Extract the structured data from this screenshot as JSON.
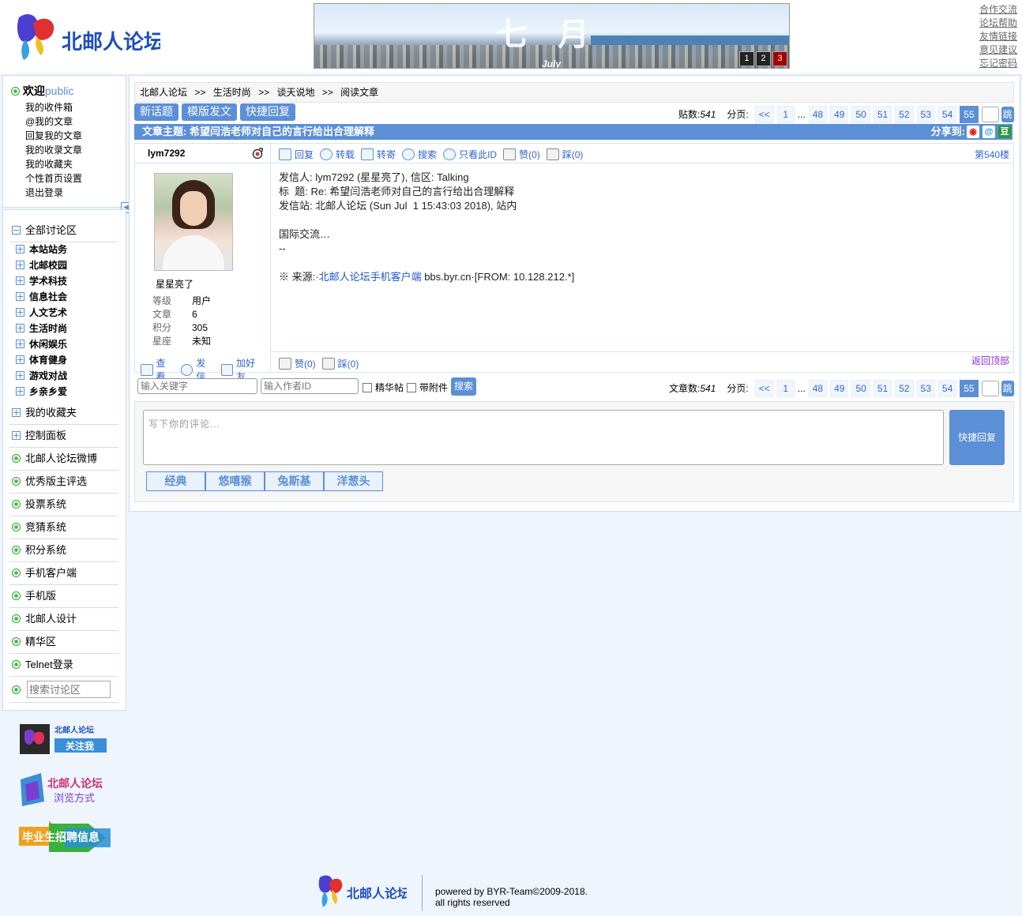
{
  "header": {
    "logo_text": "北邮人论坛",
    "banner": {
      "title": "七月",
      "subtitle": "July",
      "pages": [
        "1",
        "2",
        "3"
      ],
      "active_page": "3"
    },
    "links": [
      "合作交流",
      "论坛帮助",
      "友情链接",
      "意见建议",
      "忘记密码"
    ]
  },
  "userbox": {
    "welcome": "欢迎",
    "username": "public",
    "items": [
      "我的收件箱",
      "@我的文章",
      "回复我的文章",
      "我的收录文章",
      "我的收藏夹",
      "个性首页设置",
      "退出登录"
    ]
  },
  "nav": {
    "all_boards": "全部讨论区",
    "boards": [
      "本站站务",
      "北邮校园",
      "学术科技",
      "信息社会",
      "人文艺术",
      "生活时尚",
      "休闲娱乐",
      "体育健身",
      "游戏对战",
      "乡亲乡爱"
    ],
    "favorites": "我的收藏夹",
    "control_panel": "控制面板",
    "links": [
      "北邮人论坛微博",
      "优秀版主评选",
      "投票系统",
      "竞猜系统",
      "积分系统",
      "手机客户端",
      "手机版",
      "北邮人设计",
      "精华区",
      "Telnet登录"
    ],
    "search_placeholder": "搜索讨论区"
  },
  "ads": {
    "weibo_title": "北邮人论坛",
    "weibo_button": "关注我",
    "browse_title": "北邮人论坛",
    "browse_sub": "浏览方式",
    "jobs": "毕业生招聘信息"
  },
  "breadcrumb": [
    "北邮人论坛",
    "生活时尚",
    "谈天说地",
    "阅读文章"
  ],
  "breadcrumb_sep": ">>",
  "toolbar": {
    "new_topic": "新话题",
    "template_post": "模版发文",
    "quick_reply": "快捷回复"
  },
  "pager_top": {
    "label": "贴数:",
    "count": "541",
    "page_label": "分页:",
    "prev": "<<",
    "pages": [
      "1",
      "48",
      "49",
      "50",
      "51",
      "52",
      "53",
      "54"
    ],
    "ellipsis": "...",
    "current": "55",
    "go": "跳"
  },
  "pager_bottom": {
    "label": "文章数:",
    "count": "541",
    "page_label": "分页:",
    "prev": "<<",
    "pages": [
      "1",
      "48",
      "49",
      "50",
      "51",
      "52",
      "53",
      "54"
    ],
    "ellipsis": "...",
    "current": "55",
    "go": "跳"
  },
  "article": {
    "title": "文章主题: 希望闫浩老师对自己的言行给出合理解释",
    "share_label": "分享到:",
    "share_icons": [
      "weibo-icon",
      "tencent-icon",
      "douban-icon"
    ],
    "douban_glyph": "豆"
  },
  "post": {
    "author_id": "lym7292",
    "nickname": "星星亮了",
    "stats": [
      {
        "k": "等级",
        "v": "用户"
      },
      {
        "k": "文章",
        "v": "6"
      },
      {
        "k": "积分",
        "v": "305"
      },
      {
        "k": "星座",
        "v": "未知"
      }
    ],
    "actions_top": [
      "回复",
      "转载",
      "转寄",
      "搜索",
      "只看此ID",
      "赞(0)",
      "踩(0)"
    ],
    "floor": "第540楼",
    "lines": [
      "发信人: lym7292 (星星亮了), 信区: Talking",
      "标  题: Re: 希望闫浩老师对自己的言行给出合理解释",
      "发信站: 北邮人论坛 (Sun Jul  1 15:43:03 2018), 站内",
      "",
      "国际交流…",
      "--",
      ""
    ],
    "source_prefix": "※ 来源:·",
    "source_link": "北邮人论坛手机客户端",
    "source_suffix": " bbs.byr.cn·[FROM: 10.128.212.*]",
    "actions_author": [
      "查看",
      "发信",
      "加好友"
    ],
    "actions_bottom": [
      "赞(0)",
      "踩(0)"
    ],
    "back_top": "返回顶部"
  },
  "search": {
    "keyword_placeholder": "输入关键字",
    "author_placeholder": "输入作者ID",
    "digest_label": "精华帖",
    "attach_label": "带附件",
    "button": "搜索"
  },
  "reply": {
    "placeholder": "写下你的评论...",
    "button": "快捷回复",
    "emoticons": [
      "经典",
      "悠嘻猴",
      "兔斯基",
      "洋葱头"
    ]
  },
  "footer": {
    "logo_text": "北邮人论坛",
    "line1": "powered by BYR-Team©2009-2018.",
    "line2": "all rights reserved"
  }
}
